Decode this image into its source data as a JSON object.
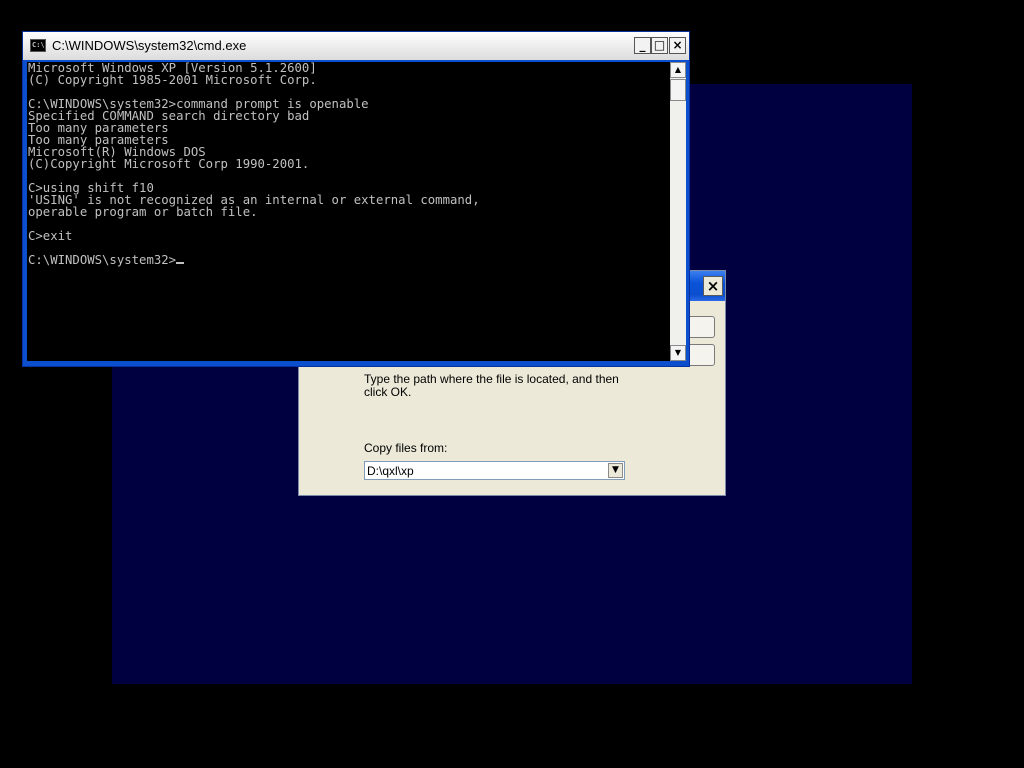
{
  "colors": {
    "screen_bg": "#000000",
    "desktop_panel": "#000040",
    "titlebar_blue": "#0b4fcf",
    "dialog_face": "#ece9d8",
    "console_bg": "#000000",
    "console_text": "#c0c0c0"
  },
  "cmd_window": {
    "title": "C:\\WINDOWS\\system32\\cmd.exe",
    "icon": "cmd-window-icon",
    "icon_text": "C:\\",
    "controls": {
      "minimize": "_",
      "maximize": "□",
      "close": "×"
    },
    "output": "Microsoft Windows XP [Version 5.1.2600]\n(C) Copyright 1985-2001 Microsoft Corp.\n\nC:\\WINDOWS\\system32>command prompt is openable\nSpecified COMMAND search directory bad\nToo many parameters\nToo many parameters\nMicrosoft(R) Windows DOS\n(C)Copyright Microsoft Corp 1990-2001.\n\nC>using shift f10\n'USING' is not recognized as an internal or external command,\noperable program or batch file.\n\nC>exit\n\nC:\\WINDOWS\\system32>",
    "scroll_up": "▲",
    "scroll_down": "▼"
  },
  "dialog": {
    "close_glyph": "×",
    "message": "Type the path where the file is located, and then click OK.",
    "copy_label": "Copy files from:",
    "path_value": "D:\\qxl\\xp",
    "combo_arrow": "▼"
  }
}
